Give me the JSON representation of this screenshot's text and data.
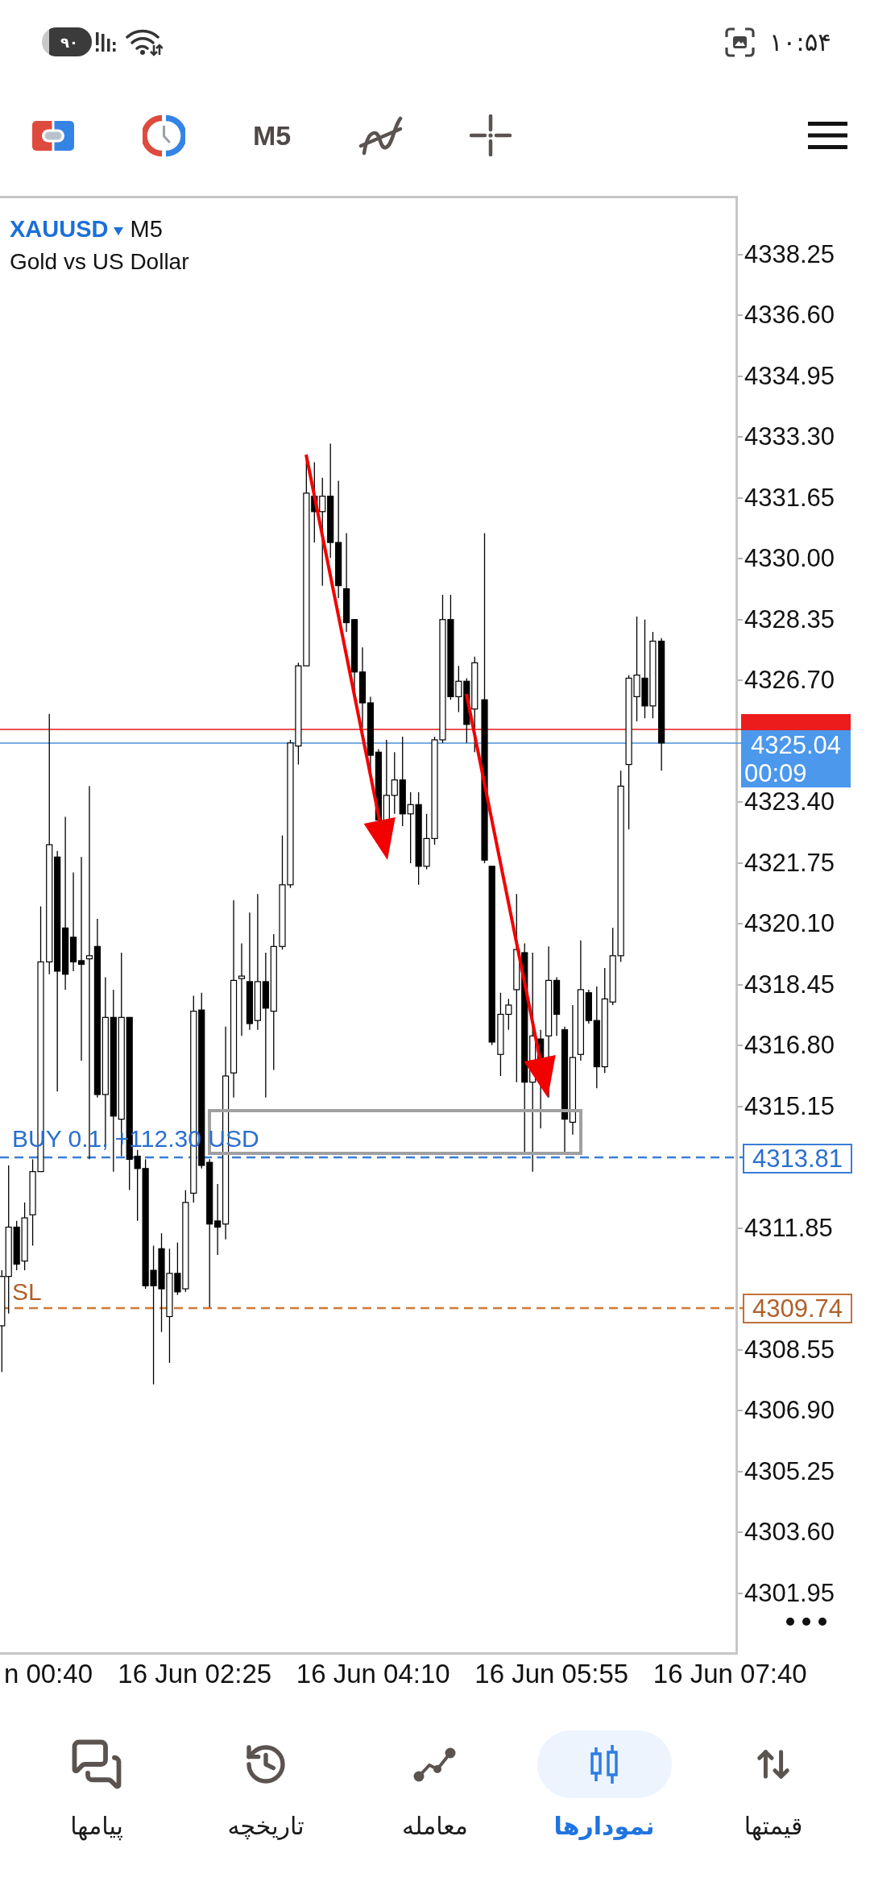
{
  "status_bar": {
    "battery": "۹۰",
    "time": "۱۰:۵۴"
  },
  "toolbar": {
    "timeframe": "M5"
  },
  "chart": {
    "symbol": "XAUUSD",
    "timeframe": "M5",
    "description": "Gold vs US Dollar",
    "price_axis": [
      [
        "4338.25",
        "4336.60",
        "4334.95",
        "4333.30",
        "4331.65",
        "4330.00",
        "4328.35",
        "4326.70"
      ],
      [
        "4323.40",
        "4321.75",
        "4320.10",
        "4318.45",
        "4316.80",
        "4315.15"
      ],
      [
        "4311.85"
      ],
      [
        "4308.55",
        "4306.90",
        "4305.25",
        "4303.60",
        "4301.95"
      ]
    ],
    "ask": {
      "price": "4325.04",
      "countdown": "00:09"
    },
    "position": {
      "label": "BUY 0.1, +112.30 USD",
      "price": "4313.81"
    },
    "stop_loss": {
      "label": "SL",
      "price": "4309.74"
    },
    "time_axis": [
      "n 00:40",
      "16 Jun 02:25",
      "16 Jun 04:10",
      "16 Jun 05:55",
      "16 Jun 07:40"
    ]
  },
  "bottom_nav": [
    {
      "kind": "quotes",
      "label": "قیمتها",
      "selected": false
    },
    {
      "kind": "charts",
      "label": "نمودارها",
      "selected": true
    },
    {
      "kind": "trade",
      "label": "معامله",
      "selected": false
    },
    {
      "kind": "history",
      "label": "تاریخچه",
      "selected": false
    },
    {
      "kind": "messages",
      "label": "پیامها",
      "selected": false
    }
  ]
}
